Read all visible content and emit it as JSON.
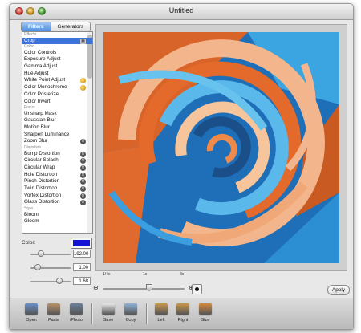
{
  "window": {
    "title": "Untitled"
  },
  "tabs": [
    {
      "label": "Filters",
      "active": true
    },
    {
      "label": "Generators",
      "active": false
    }
  ],
  "filter_list": [
    {
      "label": "Effects",
      "kind": "header"
    },
    {
      "label": "Crop",
      "kind": "item",
      "selected": true,
      "badge": "crop-icon"
    },
    {
      "label": "Color",
      "kind": "header"
    },
    {
      "label": "Color Controls",
      "kind": "item"
    },
    {
      "label": "Exposure Adjust",
      "kind": "item"
    },
    {
      "label": "Gamma Adjust",
      "kind": "item"
    },
    {
      "label": "Hue Adjust",
      "kind": "item"
    },
    {
      "label": "White Point Adjust",
      "kind": "item",
      "badge": "lightbulb-icon"
    },
    {
      "label": "Color Monochrome",
      "kind": "item",
      "badge": "lightbulb-icon"
    },
    {
      "label": "Color Posterize",
      "kind": "item"
    },
    {
      "label": "Color Invert",
      "kind": "item"
    },
    {
      "label": "Focus",
      "kind": "header"
    },
    {
      "label": "Unsharp Mask",
      "kind": "item"
    },
    {
      "label": "Gaussian Blur",
      "kind": "item"
    },
    {
      "label": "Motion Blur",
      "kind": "item"
    },
    {
      "label": "Sharpen Luminance",
      "kind": "item"
    },
    {
      "label": "Zoom Blur",
      "kind": "item",
      "badge": "crosshair-icon"
    },
    {
      "label": "Distortion",
      "kind": "header"
    },
    {
      "label": "Bump Distortion",
      "kind": "item",
      "badge": "crosshair-icon"
    },
    {
      "label": "Circular Splash",
      "kind": "item",
      "badge": "crosshair-icon"
    },
    {
      "label": "Circular Wrap",
      "kind": "item",
      "badge": "crosshair-icon"
    },
    {
      "label": "Hole Distortion",
      "kind": "item",
      "badge": "crosshair-icon"
    },
    {
      "label": "Pinch Distortion",
      "kind": "item",
      "badge": "crosshair-icon"
    },
    {
      "label": "Twirl Distortion",
      "kind": "item",
      "badge": "crosshair-icon"
    },
    {
      "label": "Vortex Distortion",
      "kind": "item",
      "badge": "crosshair-icon"
    },
    {
      "label": "Glass Distortion",
      "kind": "item",
      "badge": "crosshair-icon"
    },
    {
      "label": "Style",
      "kind": "header"
    },
    {
      "label": "Bloom",
      "kind": "item"
    },
    {
      "label": "Gloom",
      "kind": "item"
    }
  ],
  "params": {
    "color_label": "Color:",
    "color_value": "#1313d6",
    "sliders": [
      {
        "value": "192.00",
        "level": 0.2
      },
      {
        "value": "1.00",
        "level": 0.1
      },
      {
        "value": "1.68",
        "level": 0.7
      }
    ]
  },
  "zoom": {
    "min": "1/4x",
    "mid": "1x",
    "max": "8x",
    "level": 0.55,
    "minus": "⊖",
    "plus": "⊕"
  },
  "apply_label": "Apply",
  "toolbar": [
    {
      "label": "Open",
      "icon": "open-icon",
      "color": "#6b8fc9"
    },
    {
      "label": "Paste",
      "icon": "paste-icon",
      "color": "#b7946b"
    },
    {
      "label": "iPhoto",
      "icon": "iphoto-icon",
      "color": "#6c7f9a"
    },
    {
      "label": "Save",
      "icon": "save-icon",
      "color": "#e8e8e8"
    },
    {
      "label": "Copy",
      "icon": "copy-icon",
      "color": "#8fb2d8"
    },
    {
      "label": "Left",
      "icon": "rotate-left-icon",
      "color": "#c9974e"
    },
    {
      "label": "Right",
      "icon": "rotate-right-icon",
      "color": "#c9974e"
    },
    {
      "label": "Size",
      "icon": "resize-icon",
      "color": "#d58a3c"
    }
  ],
  "colors": {
    "accent": "#3b73d8",
    "swirl_orange": "#e2662a",
    "swirl_blue": "#2a9ad8",
    "swirl_peach": "#f2b48a"
  }
}
